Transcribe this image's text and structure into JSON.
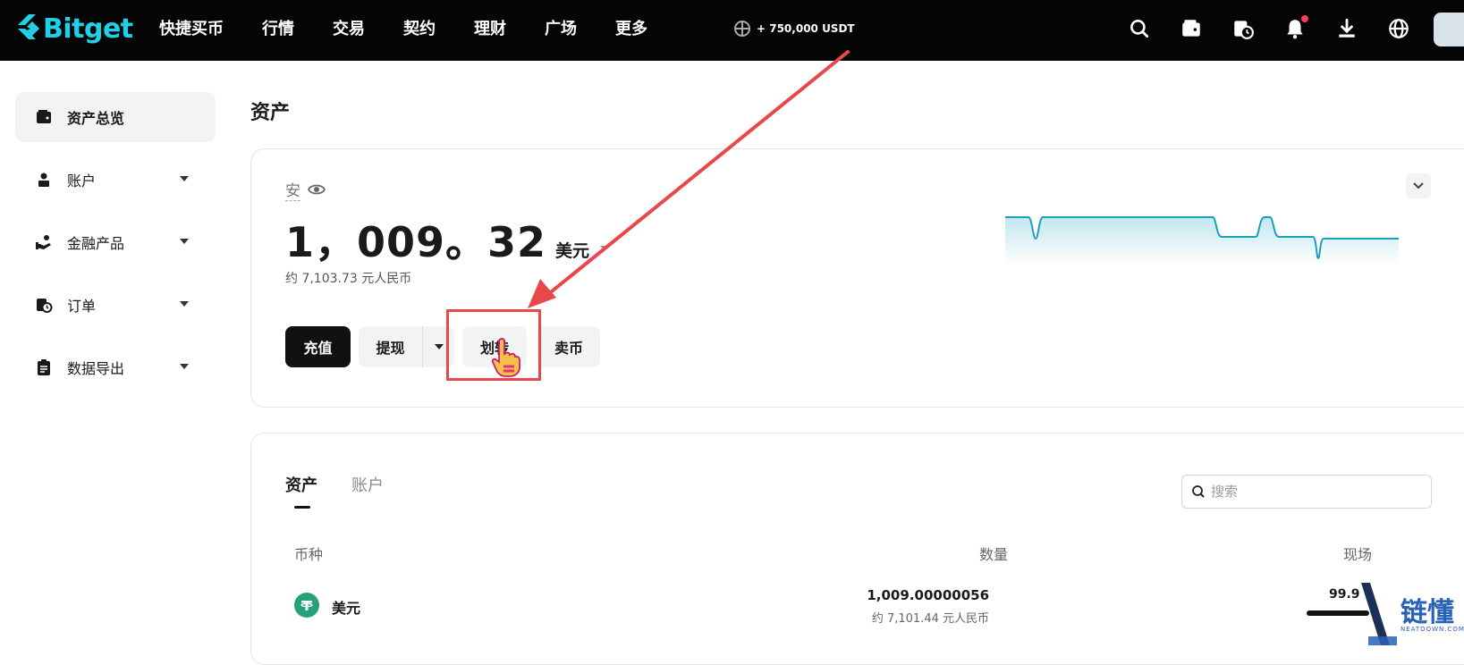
{
  "brand": {
    "name": "Bitget",
    "color": "#1fd1e8"
  },
  "nav": [
    "快捷买币",
    "行情",
    "交易",
    "契约",
    "理财",
    "广场",
    "更多"
  ],
  "promo": {
    "text": "+ 750,000 USDT"
  },
  "top_icons": [
    "search-icon",
    "wallet-icon",
    "orders-clock-icon",
    "bell-icon",
    "download-icon",
    "globe-icon"
  ],
  "sidebar": {
    "items": [
      {
        "label": "资产总览",
        "icon": "wallet-icon",
        "active": true
      },
      {
        "label": "账户",
        "icon": "user-icon"
      },
      {
        "label": "金融产品",
        "icon": "finance-hand-icon"
      },
      {
        "label": "订单",
        "icon": "orders-clock-icon"
      },
      {
        "label": "数据导出",
        "icon": "clipboard-icon"
      }
    ]
  },
  "page": {
    "title": "资产"
  },
  "overview": {
    "hide_label": "安",
    "balance": "1，009。32",
    "unit": "美元",
    "approx": "约 7,103.73 元人民币",
    "buttons": {
      "deposit": "充值",
      "withdraw": "提现",
      "transfer": "划转",
      "sell": "卖币"
    }
  },
  "assets": {
    "tabs": [
      "资产",
      "账户"
    ],
    "search_placeholder": "搜索",
    "columns": {
      "coin": "币种",
      "qty": "数量",
      "spot": "现场"
    },
    "rows": [
      {
        "name": "美元",
        "qty": "1,009.00000056",
        "qty_approx": "约 7,101.44 元人民币",
        "spot": "99.9"
      }
    ]
  },
  "annotation": {
    "highlight_color": "#e8484a"
  },
  "watermark": {
    "text": "链懂",
    "sub": "NEATDOWN.COM"
  }
}
